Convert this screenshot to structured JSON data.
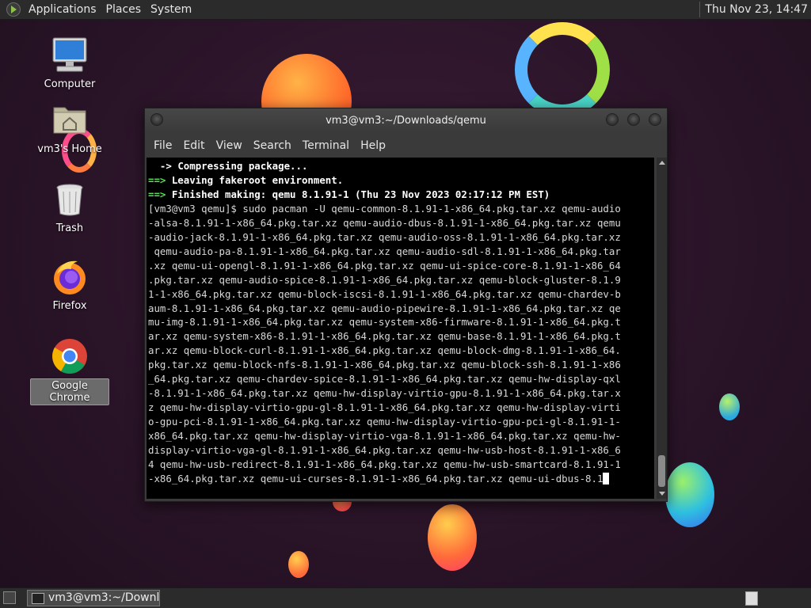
{
  "top_panel": {
    "menus": [
      "Applications",
      "Places",
      "System"
    ],
    "clock": "Thu Nov 23, 14:47"
  },
  "desktop_icons": [
    {
      "label": "Computer",
      "icon": "computer-icon"
    },
    {
      "label": "vm3's Home",
      "icon": "home-folder-icon"
    },
    {
      "label": "Trash",
      "icon": "trash-icon"
    },
    {
      "label": "Firefox",
      "icon": "firefox-icon"
    },
    {
      "label": "Google Chrome",
      "icon": "chrome-icon",
      "selected": true
    }
  ],
  "terminal": {
    "title": "vm3@vm3:~/Downloads/qemu",
    "menus": [
      "File",
      "Edit",
      "View",
      "Search",
      "Terminal",
      "Help"
    ],
    "lines": [
      {
        "prefix": "  -> ",
        "text": "Compressing package...",
        "style": "bold-arrow"
      },
      {
        "prefix": "==> ",
        "text": "Leaving fakeroot environment.",
        "style": "bold-green"
      },
      {
        "prefix": "==> ",
        "text": "Finished making: qemu 8.1.91-1 (Thu 23 Nov 2023 02:17:12 PM EST)",
        "style": "bold-green"
      },
      {
        "text": "[vm3@vm3 qemu]$ sudo pacman -U qemu-common-8.1.91-1-x86_64.pkg.tar.xz qemu-audio"
      },
      {
        "text": "-alsa-8.1.91-1-x86_64.pkg.tar.xz qemu-audio-dbus-8.1.91-1-x86_64.pkg.tar.xz qemu"
      },
      {
        "text": "-audio-jack-8.1.91-1-x86_64.pkg.tar.xz qemu-audio-oss-8.1.91-1-x86_64.pkg.tar.xz"
      },
      {
        "text": " qemu-audio-pa-8.1.91-1-x86_64.pkg.tar.xz qemu-audio-sdl-8.1.91-1-x86_64.pkg.tar"
      },
      {
        "text": ".xz qemu-ui-opengl-8.1.91-1-x86_64.pkg.tar.xz qemu-ui-spice-core-8.1.91-1-x86_64"
      },
      {
        "text": ".pkg.tar.xz qemu-audio-spice-8.1.91-1-x86_64.pkg.tar.xz qemu-block-gluster-8.1.9"
      },
      {
        "text": "1-1-x86_64.pkg.tar.xz qemu-block-iscsi-8.1.91-1-x86_64.pkg.tar.xz qemu-chardev-b"
      },
      {
        "text": "aum-8.1.91-1-x86_64.pkg.tar.xz qemu-audio-pipewire-8.1.91-1-x86_64.pkg.tar.xz qe"
      },
      {
        "text": "mu-img-8.1.91-1-x86_64.pkg.tar.xz qemu-system-x86-firmware-8.1.91-1-x86_64.pkg.t"
      },
      {
        "text": "ar.xz qemu-system-x86-8.1.91-1-x86_64.pkg.tar.xz qemu-base-8.1.91-1-x86_64.pkg.t"
      },
      {
        "text": "ar.xz qemu-block-curl-8.1.91-1-x86_64.pkg.tar.xz qemu-block-dmg-8.1.91-1-x86_64."
      },
      {
        "text": "pkg.tar.xz qemu-block-nfs-8.1.91-1-x86_64.pkg.tar.xz qemu-block-ssh-8.1.91-1-x86"
      },
      {
        "text": "_64.pkg.tar.xz qemu-chardev-spice-8.1.91-1-x86_64.pkg.tar.xz qemu-hw-display-qxl"
      },
      {
        "text": "-8.1.91-1-x86_64.pkg.tar.xz qemu-hw-display-virtio-gpu-8.1.91-1-x86_64.pkg.tar.x"
      },
      {
        "text": "z qemu-hw-display-virtio-gpu-gl-8.1.91-1-x86_64.pkg.tar.xz qemu-hw-display-virti"
      },
      {
        "text": "o-gpu-pci-8.1.91-1-x86_64.pkg.tar.xz qemu-hw-display-virtio-gpu-pci-gl-8.1.91-1-"
      },
      {
        "text": "x86_64.pkg.tar.xz qemu-hw-display-virtio-vga-8.1.91-1-x86_64.pkg.tar.xz qemu-hw-"
      },
      {
        "text": "display-virtio-vga-gl-8.1.91-1-x86_64.pkg.tar.xz qemu-hw-usb-host-8.1.91-1-x86_6"
      },
      {
        "text": "4 qemu-hw-usb-redirect-8.1.91-1-x86_64.pkg.tar.xz qemu-hw-usb-smartcard-8.1.91-1"
      },
      {
        "text": "-x86_64.pkg.tar.xz qemu-ui-curses-8.1.91-1-x86_64.pkg.tar.xz qemu-ui-dbus-8.1",
        "cursor": true
      }
    ]
  },
  "taskbar": {
    "task_label": "vm3@vm3:~/Downl..."
  }
}
